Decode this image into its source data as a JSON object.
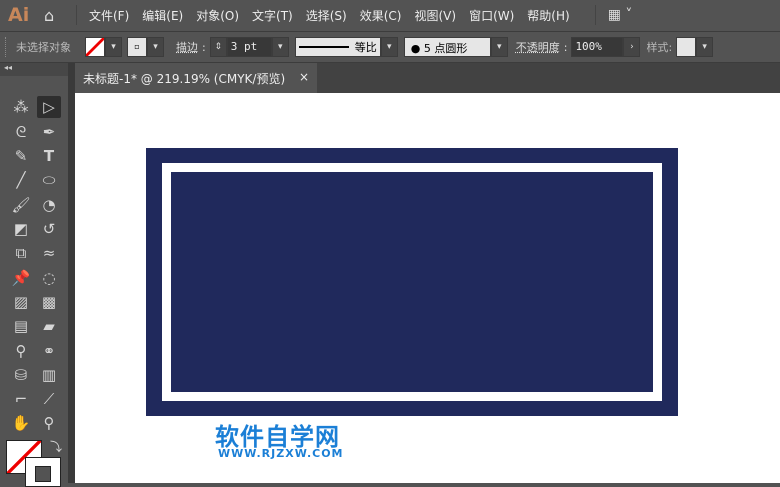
{
  "app": {
    "logo": "Ai"
  },
  "menu": [
    "文件(F)",
    "编辑(E)",
    "对象(O)",
    "文字(T)",
    "选择(S)",
    "效果(C)",
    "视图(V)",
    "窗口(W)",
    "帮助(H)"
  ],
  "control": {
    "selection": "未选择对象",
    "stroke_label": "描边",
    "stroke_value": "3 pt",
    "profile": "等比",
    "brush": "5 点圆形",
    "opacity_label": "不透明度",
    "opacity_value": "100%",
    "style_label": "样式"
  },
  "tab": {
    "title": "未标题-1* @ 219.19% (CMYK/预览)",
    "close": "×"
  },
  "colors": {
    "navy": "#20295c",
    "watermark": "#1b7fd6"
  },
  "watermark": {
    "title": "软件自学网",
    "url": "WWW.RJZXW.COM"
  }
}
